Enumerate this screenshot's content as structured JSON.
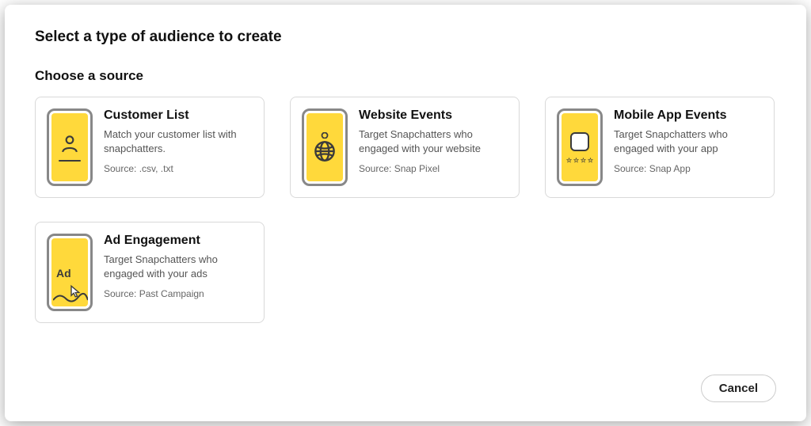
{
  "header": {
    "title": "Select a type of audience to create"
  },
  "section": {
    "title": "Choose a source"
  },
  "cards": [
    {
      "title": "Customer List",
      "desc": "Match your customer list with snapchatters.",
      "source": "Source: .csv, .txt"
    },
    {
      "title": "Website Events",
      "desc": "Target Snapchatters who engaged with your website",
      "source": "Source: Snap Pixel"
    },
    {
      "title": "Mobile App Events",
      "desc": "Target Snapchatters who engaged with your app",
      "source": "Source: Snap App"
    },
    {
      "title": "Ad Engagement",
      "desc": "Target Snapchatters who engaged with your ads",
      "source": "Source: Past Campaign"
    }
  ],
  "ad_label": "Ad",
  "footer": {
    "cancel_label": "Cancel"
  }
}
